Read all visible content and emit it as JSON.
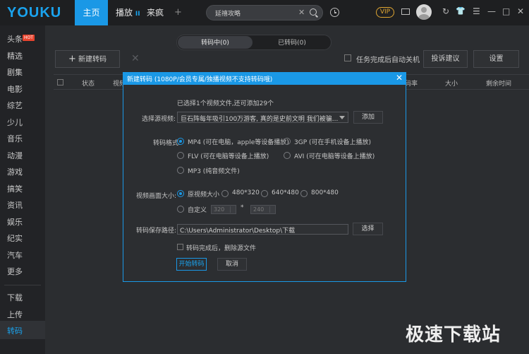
{
  "header": {
    "logo": "YOUKU",
    "tabs": [
      "主页",
      "播放",
      "来疯"
    ],
    "play_badge": "II",
    "add_tab": "+",
    "search": {
      "value": "延禧攻略",
      "clear": "✕"
    },
    "vip": "VIP",
    "window_buttons": {
      "refresh": "↻",
      "skin": "👕",
      "menu": "☰",
      "minimize": "—",
      "maximize": "□",
      "close": "✕"
    }
  },
  "sidebar": {
    "items": [
      "头条",
      "精选",
      "剧集",
      "电影",
      "综艺",
      "少儿",
      "音乐",
      "动漫",
      "游戏",
      "搞笑",
      "资讯",
      "娱乐",
      "纪实",
      "汽车",
      "更多"
    ],
    "hot_badge": "HOT",
    "bottom_items": [
      "下载",
      "上传"
    ],
    "active_item": "转码"
  },
  "main": {
    "segment": {
      "active": "转码中(0)",
      "other": "已转码(0)"
    },
    "new_button": "新建转码",
    "new_icon": "+",
    "delete_icon": "✕",
    "auto_shutdown": "任务完成后自动关机",
    "complain_button": "投诉建议",
    "settings_button": "设置",
    "columns": [
      "状态",
      "视频",
      "码率",
      "大小",
      "剩余时间"
    ]
  },
  "dialog": {
    "title": "新建转码 (1080P/会员专属/独播视频不支持转码哦)",
    "close": "✕",
    "info": "已选择1个视频文件,还可添加29个",
    "source_label": "选择源视频:",
    "source_value": "巨石阵每年吸引100万游客, 真的是史前文明 我们被骗...",
    "add_button": "添加",
    "format_label": "转码格式:",
    "formats": [
      {
        "label": "MP4 (可在电脑，apple等设备播放)",
        "selected": true
      },
      {
        "label": "3GP (可在手机设备上播放)",
        "selected": false
      },
      {
        "label": "FLV (可在电脑等设备上播放)",
        "selected": false
      },
      {
        "label": "AVI (可在电脑等设备上播放)",
        "selected": false
      },
      {
        "label": "MP3 (纯音频文件)",
        "selected": false
      }
    ],
    "size_label": "视频画面大小:",
    "sizes": [
      {
        "label": "原视频大小",
        "selected": true
      },
      {
        "label": "480*320",
        "selected": false
      },
      {
        "label": "640*480",
        "selected": false
      },
      {
        "label": "800*480",
        "selected": false
      },
      {
        "label": "自定义",
        "selected": false
      }
    ],
    "custom_width": "320",
    "custom_times": "*",
    "custom_height": "240",
    "path_label": "转码保存路径:",
    "path_value": "C:\\Users\\Administrator\\Desktop\\下载",
    "choose_button": "选择",
    "delete_after_label": "转码完成后，删除源文件",
    "start_button": "开始转码",
    "cancel_button": "取消"
  },
  "watermark": "极速下载站",
  "colors": {
    "accent": "#1a98e6",
    "vip": "#e0a632",
    "hot": "#e8442e",
    "background": "#2b2d30"
  }
}
